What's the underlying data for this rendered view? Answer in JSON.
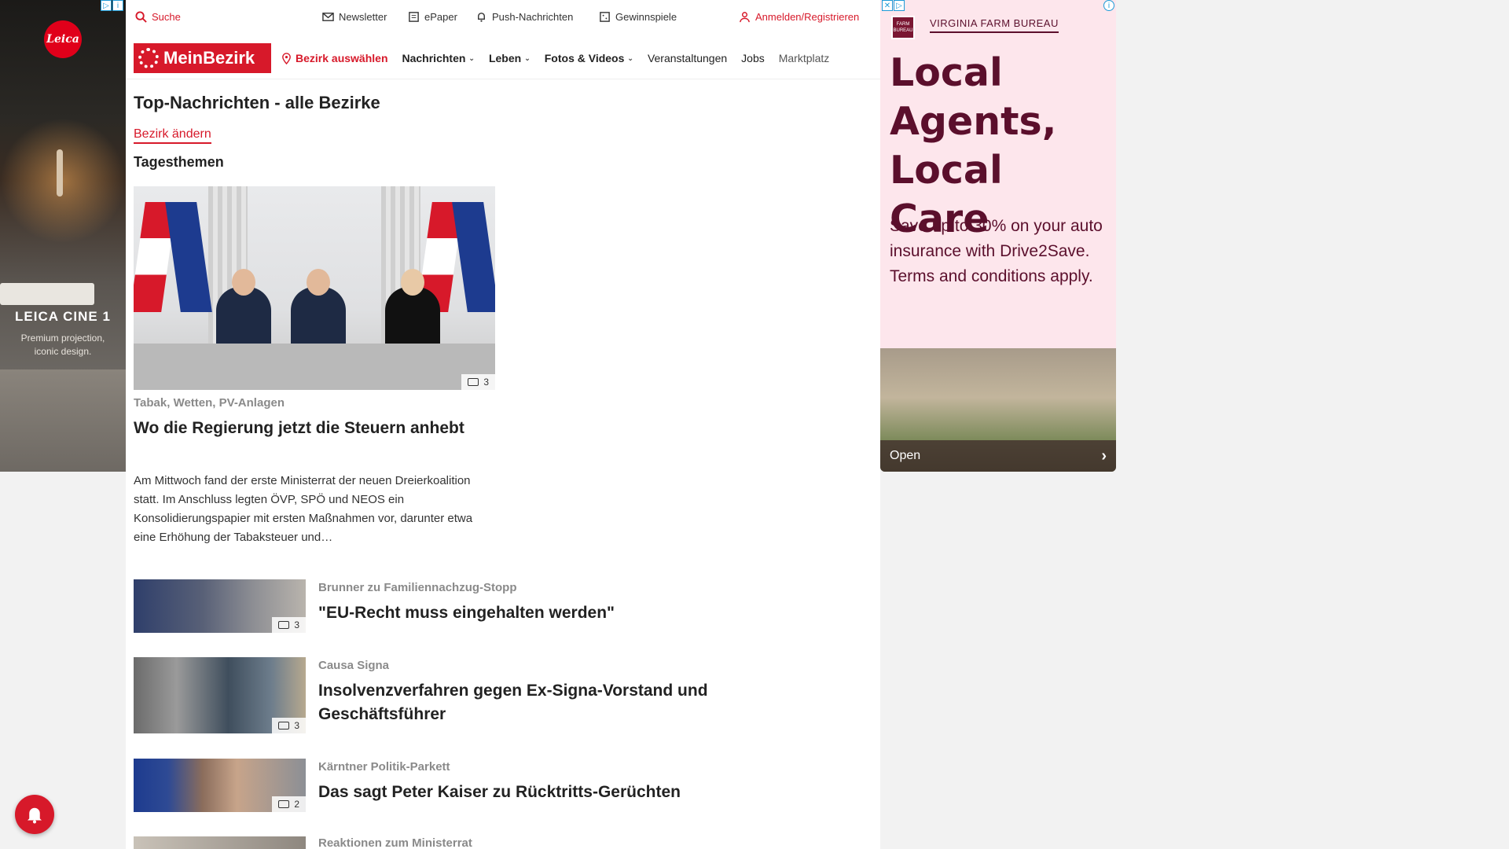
{
  "left_ad": {
    "brand": "Leica",
    "title": "LEICA CINE 1",
    "subtitle": "Premium projection, iconic design."
  },
  "topbar": {
    "search": "Suche",
    "newsletter": "Newsletter",
    "epaper": "ePaper",
    "push": "Push-Nachrichten",
    "gewinnspiele": "Gewinnspiele",
    "login": "Anmelden/Registrieren"
  },
  "nav": {
    "brand": "MeinBezirk",
    "bezirk": "Bezirk auswählen",
    "items": [
      "Nachrichten",
      "Leben",
      "Fotos & Videos",
      "Veranstaltungen",
      "Jobs",
      "Marktplatz"
    ]
  },
  "page": {
    "title": "Top-Nachrichten - alle Bezirke",
    "change_link": "Bezirk ändern",
    "section": "Tagesthemen"
  },
  "hero": {
    "image_count": "3",
    "kicker": "Tabak, Wetten, PV-Anlagen",
    "headline": "Wo die Regierung jetzt die Steuern anhebt",
    "teaser": "Am Mittwoch fand der erste Ministerrat der neuen Dreierkoalition statt. Im Anschluss legten ÖVP, SPÖ und NEOS ein Konsolidierungspapier mit ersten Maßnahmen vor, darunter etwa eine Erhöhung der Tabaksteuer und…"
  },
  "articles": [
    {
      "kicker": "Brunner zu Familiennachzug-Stopp",
      "headline": "\"EU-Recht muss eingehalten werden\"",
      "image_count": "3"
    },
    {
      "kicker": "Causa Signa",
      "headline": "Insolvenzverfahren gegen Ex-Signa-Vorstand und Geschäftsführer",
      "image_count": "3"
    },
    {
      "kicker": "Kärntner Politik-Parkett",
      "headline": "Das sagt Peter Kaiser zu Rücktritts-Gerüchten",
      "image_count": "2"
    },
    {
      "kicker": "Reaktionen zum Ministerrat",
      "headline": "",
      "image_count": ""
    }
  ],
  "right_ad": {
    "org": "VIRGINIA FARM BUREAU",
    "logo_text": "FARM BUREAU",
    "headline": "Local Agents, Local Care",
    "copy": "Save up to 30% on your auto insurance with Drive2Save. Terms and conditions apply.",
    "cta": "Open"
  },
  "colors": {
    "brand_red": "#d7192a",
    "ad_maroon": "#5b0f2c",
    "ad_pink": "#fde6ec"
  }
}
